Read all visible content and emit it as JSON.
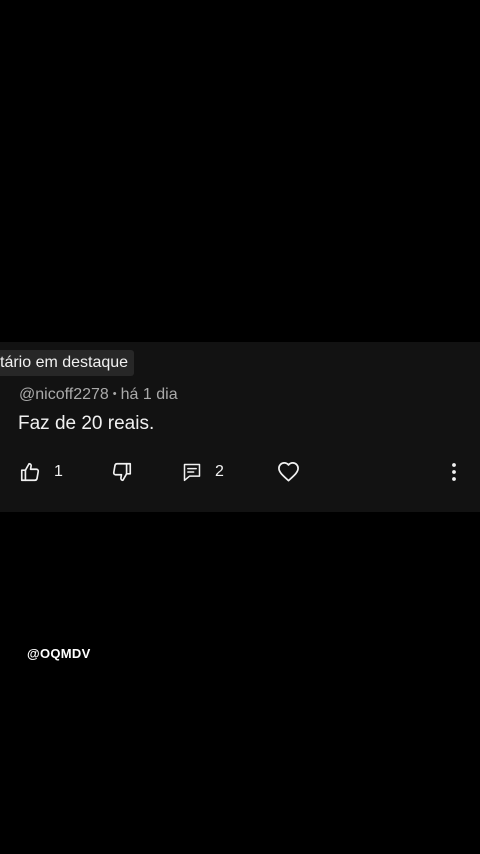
{
  "comment": {
    "featured_label": "tário em destaque",
    "author": "@nicoff2278",
    "separator": "•",
    "time_ago": "há 1 dia",
    "text": "Faz de 20 reais.",
    "like_count": "1",
    "reply_count": "2"
  },
  "icons": {
    "like": "thumbs-up-icon",
    "dislike": "thumbs-down-icon",
    "reply": "comment-icon",
    "heart": "heart-icon",
    "more": "more-vertical-icon"
  },
  "watermark": "@OQMDV",
  "colors": {
    "background": "#000000",
    "card": "#121212",
    "label_bg": "#272727",
    "text": "#f1f1f1",
    "meta": "#aaaaaa"
  }
}
